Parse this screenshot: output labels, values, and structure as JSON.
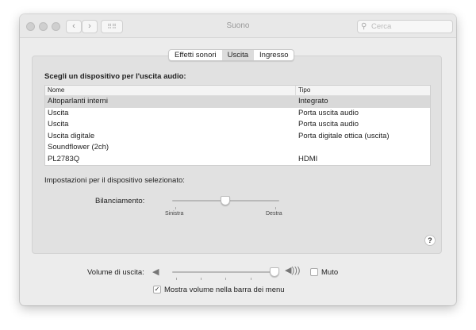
{
  "window": {
    "title": "Suono",
    "search_placeholder": "Cerca"
  },
  "tabs": [
    {
      "label": "Effetti sonori",
      "selected": false
    },
    {
      "label": "Uscita",
      "selected": true
    },
    {
      "label": "Ingresso",
      "selected": false
    }
  ],
  "output": {
    "heading": "Scegli un dispositivo per l'uscita audio:",
    "columns": [
      "Nome",
      "Tipo"
    ],
    "rows": [
      {
        "name": "Altoparlanti interni",
        "type": "Integrato",
        "selected": true
      },
      {
        "name": "Uscita",
        "type": "Porta uscita audio"
      },
      {
        "name": "Uscita",
        "type": "Porta uscita audio"
      },
      {
        "name": "Uscita digitale",
        "type": "Porta digitale ottica (uscita)"
      },
      {
        "name": "Soundflower (2ch)",
        "type": ""
      },
      {
        "name": "PL2783Q",
        "type": "HDMI"
      }
    ],
    "settings_label": "Impostazioni per il dispositivo selezionato:",
    "balance": {
      "label": "Bilanciamento:",
      "left": "Sinistra",
      "right": "Destra",
      "value": 0.5
    }
  },
  "help": "?",
  "volume": {
    "label": "Volume di uscita:",
    "value": 1.0,
    "mute_label": "Muto",
    "mute": false,
    "show_in_menu_label": "Mostra volume nella barra dei menu",
    "show_in_menu": true,
    "check": "✓"
  }
}
